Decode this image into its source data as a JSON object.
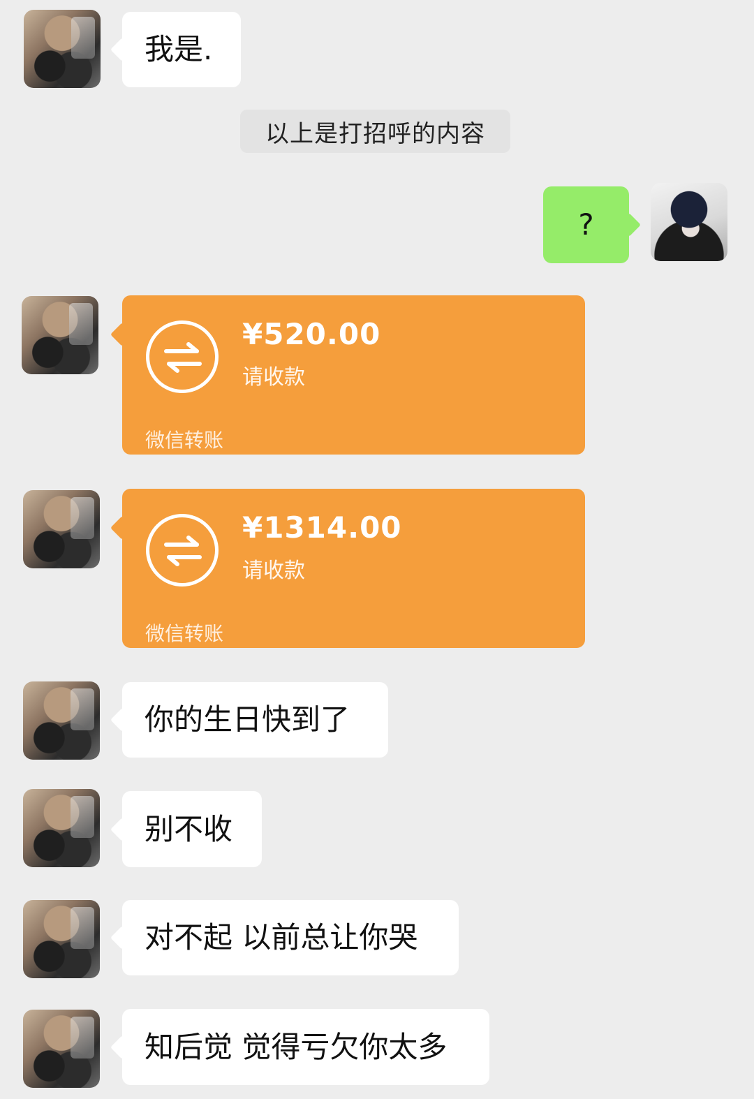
{
  "messages": [
    {
      "side": "left",
      "text": "我是.",
      "avatar_icon": "user-avatar-icon"
    },
    {
      "system_text": "以上是打招呼的内容"
    },
    {
      "side": "right",
      "text": "?",
      "avatar_icon": "user-avatar-icon"
    },
    {
      "side": "left",
      "type": "transfer",
      "amount": "¥520.00",
      "status": "请收款",
      "footer": "微信转账",
      "icon": "transfer-icon"
    },
    {
      "side": "left",
      "type": "transfer",
      "amount": "¥1314.00",
      "status": "请收款",
      "footer": "微信转账",
      "icon": "transfer-icon"
    },
    {
      "side": "left",
      "text": "你的生日快到了"
    },
    {
      "side": "left",
      "text": "别不收"
    },
    {
      "side": "left",
      "text": "对不起 以前总让你哭"
    },
    {
      "side": "left",
      "text": "知后觉 觉得亏欠你太多"
    }
  ],
  "colors": {
    "background": "#ededed",
    "left_bubble": "#ffffff",
    "right_bubble": "#95ec69",
    "transfer_card": "#f59e3c"
  }
}
